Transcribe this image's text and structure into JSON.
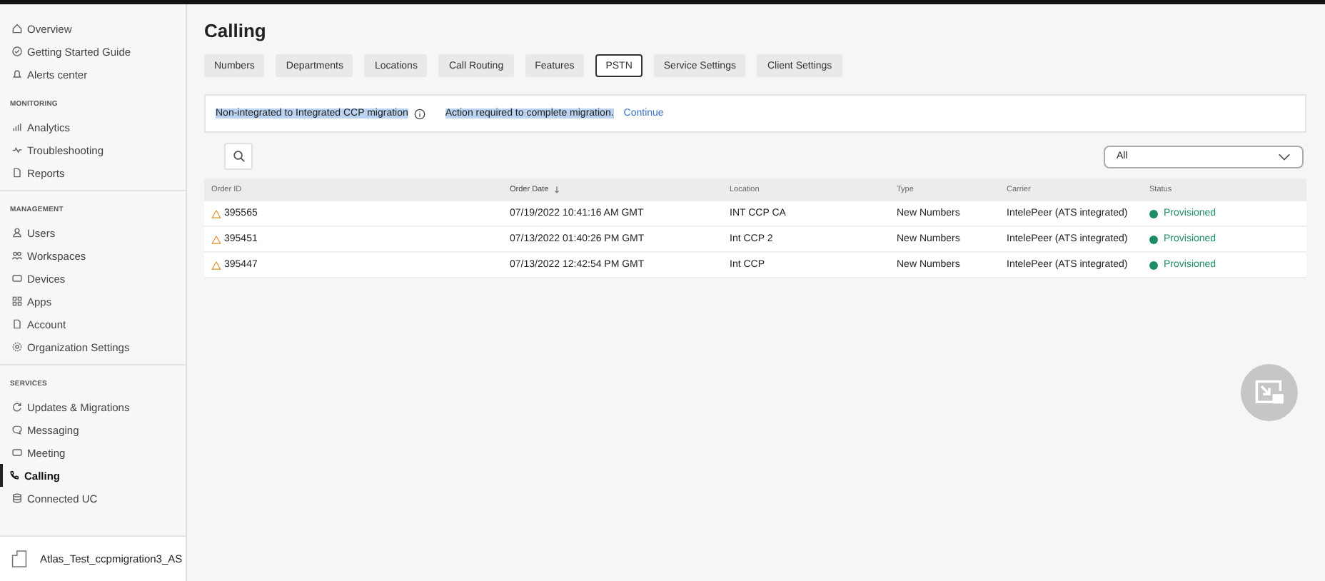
{
  "sidebar": {
    "sections": [
      {
        "items": [
          {
            "label": "Overview",
            "selected": false
          },
          {
            "label": "Getting Started Guide",
            "selected": false
          },
          {
            "label": "Alerts center",
            "selected": false
          }
        ]
      },
      {
        "heading": "MONITORING",
        "items": [
          {
            "label": "Analytics",
            "selected": false
          },
          {
            "label": "Troubleshooting",
            "selected": false
          },
          {
            "label": "Reports",
            "selected": false
          }
        ]
      },
      {
        "heading": "MANAGEMENT",
        "items": [
          {
            "label": "Users",
            "selected": false
          },
          {
            "label": "Workspaces",
            "selected": false
          },
          {
            "label": "Devices",
            "selected": false
          },
          {
            "label": "Apps",
            "selected": false
          },
          {
            "label": "Account",
            "selected": false
          },
          {
            "label": "Organization Settings",
            "selected": false
          }
        ]
      },
      {
        "heading": "SERVICES",
        "items": [
          {
            "label": "Updates & Migrations",
            "selected": false
          },
          {
            "label": "Messaging",
            "selected": false
          },
          {
            "label": "Meeting",
            "selected": false
          },
          {
            "label": "Calling",
            "selected": true
          },
          {
            "label": "Connected UC",
            "selected": false
          }
        ]
      }
    ],
    "footer": {
      "org_name": "Atlas_Test_ccpmigration3_AS"
    }
  },
  "page": {
    "title": "Calling",
    "tabs": [
      {
        "label": "Numbers",
        "selected": false
      },
      {
        "label": "Departments",
        "selected": false
      },
      {
        "label": "Locations",
        "selected": false
      },
      {
        "label": "Call Routing",
        "selected": false
      },
      {
        "label": "Features",
        "selected": false
      },
      {
        "label": "PSTN",
        "selected": true
      },
      {
        "label": "Service Settings",
        "selected": false
      },
      {
        "label": "Client Settings",
        "selected": false
      }
    ],
    "banner": {
      "title": "Non-integrated to Integrated CCP migration",
      "message": "Action required to complete migration.",
      "link": "Continue",
      "text_highlighted": true
    },
    "filter": {
      "value": "All"
    },
    "table": {
      "columns": [
        {
          "label": "Order ID",
          "sorted": false
        },
        {
          "label": "Order Date",
          "sorted": true
        },
        {
          "label": "Location",
          "sorted": false
        },
        {
          "label": "Type",
          "sorted": false
        },
        {
          "label": "Carrier",
          "sorted": false
        },
        {
          "label": "Status",
          "sorted": false
        }
      ],
      "rows": [
        {
          "order_id": "395565",
          "date": "07/19/2022 10:41:16 AM GMT",
          "location": "INT CCP CA",
          "type": "New Numbers",
          "carrier": "IntelePeer (ATS integrated)",
          "status": "Provisioned",
          "color": "#1d8c6b"
        },
        {
          "order_id": "395451",
          "date": "07/13/2022 01:40:26 PM GMT",
          "location": "Int CCP 2",
          "type": "New Numbers",
          "carrier": "IntelePeer (ATS integrated)",
          "status": "Provisioned",
          "color": "#1d8c6b"
        },
        {
          "order_id": "395447",
          "date": "07/13/2022 12:42:54 PM GMT",
          "location": "Int CCP",
          "type": "New Numbers",
          "carrier": "IntelePeer (ATS integrated)",
          "status": "Provisioned",
          "color": "#1d8c6b"
        }
      ]
    }
  }
}
